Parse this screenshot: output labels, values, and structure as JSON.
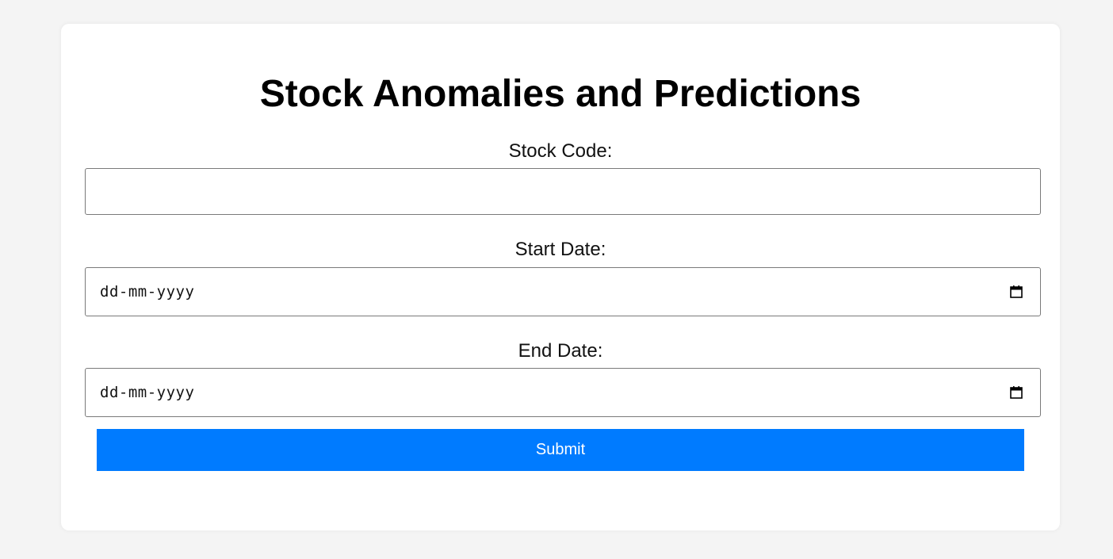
{
  "form": {
    "title": "Stock Anomalies and Predictions",
    "stock_code": {
      "label": "Stock Code:",
      "value": ""
    },
    "start_date": {
      "label": "Start Date:",
      "placeholder": "dd-mm-yyyy",
      "icon": "calendar-icon"
    },
    "end_date": {
      "label": "End Date:",
      "placeholder": "dd-mm-yyyy",
      "icon": "calendar-icon"
    },
    "submit_label": "Submit"
  },
  "colors": {
    "background": "#f4f4f4",
    "card": "#ffffff",
    "accent": "#007bff",
    "border": "#7a7a7a"
  }
}
